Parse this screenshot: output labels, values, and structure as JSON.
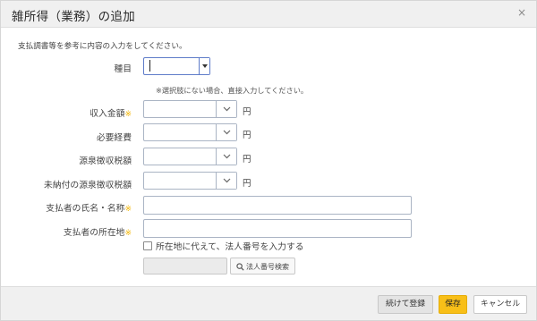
{
  "dialog": {
    "title": "雑所得（業務）の追加",
    "close_glyph": "×"
  },
  "intro": "支払調書等を参考に内容の入力をしてください。",
  "fields": {
    "type": {
      "label": "種目",
      "value": ""
    },
    "type_note": "※選択肢にない場合、直接入力してください。",
    "income": {
      "label": "収入金額",
      "required_mark": "※",
      "unit": "円",
      "value": ""
    },
    "expenses": {
      "label": "必要経費",
      "unit": "円",
      "value": ""
    },
    "withholding": {
      "label": "源泉徴収税額",
      "unit": "円",
      "value": ""
    },
    "unpaid_withholding": {
      "label": "未納付の源泉徴収税額",
      "unit": "円",
      "value": ""
    },
    "payer_name": {
      "label": "支払者の氏名・名称",
      "required_mark": "※",
      "value": ""
    },
    "payer_address": {
      "label": "支払者の所在地",
      "required_mark": "※",
      "value": ""
    },
    "corp_number_checkbox": {
      "label": "所在地に代えて、法人番号を入力する",
      "checked": false
    },
    "corp_number": {
      "value": "",
      "search_label": "法人番号検索"
    }
  },
  "footer": {
    "continue_label": "続けて登録",
    "save_label": "保存",
    "cancel_label": "キャンセル"
  },
  "colors": {
    "accent_save": "#f8bf18",
    "required_mark": "#f2b400",
    "focus_border": "#5f7cc9"
  },
  "icons": [
    "close-icon",
    "chevron-down-icon",
    "dropdown-triangle-icon",
    "search-icon",
    "checkbox-icon"
  ]
}
